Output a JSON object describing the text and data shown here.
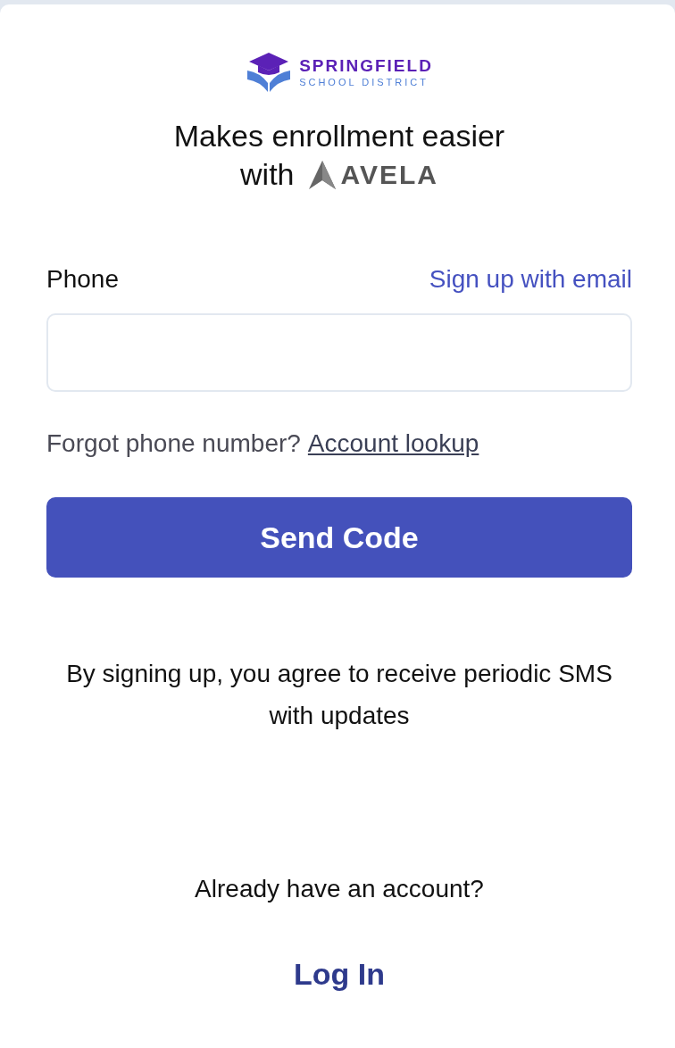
{
  "logo": {
    "name": "SPRINGFIELD",
    "subtitle": "SCHOOL DISTRICT"
  },
  "tagline": {
    "line1": "Makes enrollment easier",
    "line2": "with",
    "brand": "AVELA"
  },
  "phone": {
    "label": "Phone",
    "alt_link": "Sign up with email"
  },
  "lookup": {
    "text": "Forgot phone number?",
    "link": "Account lookup"
  },
  "submit": "Send Code",
  "notice": "By signing up, you agree to receive periodic SMS with updates",
  "login": {
    "prompt": "Already have an account?",
    "link": "Log In"
  }
}
